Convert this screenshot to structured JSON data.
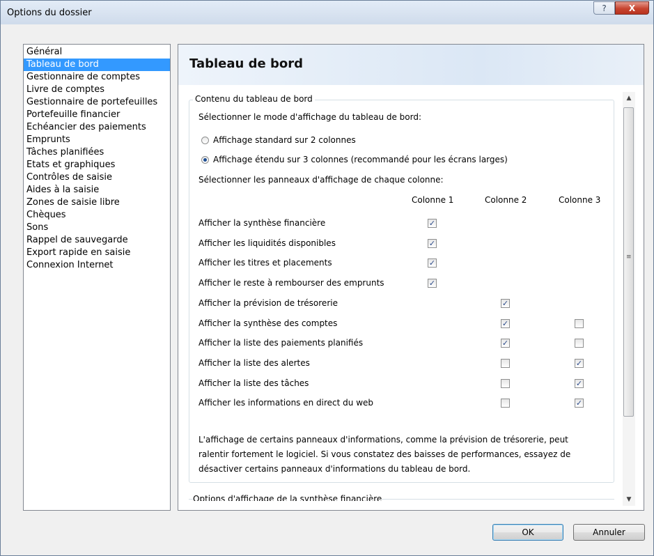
{
  "window": {
    "title": "Options du dossier",
    "help_label": "?",
    "close_label": "X"
  },
  "sidebar": {
    "items": [
      {
        "label": "Général"
      },
      {
        "label": "Tableau de bord",
        "selected": true
      },
      {
        "label": "Gestionnaire de comptes"
      },
      {
        "label": "Livre de comptes"
      },
      {
        "label": "Gestionnaire de portefeuilles"
      },
      {
        "label": "Portefeuille financier"
      },
      {
        "label": "Echéancier des paiements"
      },
      {
        "label": "Emprunts"
      },
      {
        "label": "Tâches planifiées"
      },
      {
        "label": "Etats et graphiques"
      },
      {
        "label": "Contrôles de saisie"
      },
      {
        "label": "Aides à la saisie"
      },
      {
        "label": "Zones de saisie libre"
      },
      {
        "label": "Chèques"
      },
      {
        "label": "Sons"
      },
      {
        "label": "Rappel de sauvegarde"
      },
      {
        "label": "Export rapide en saisie"
      },
      {
        "label": "Connexion Internet"
      }
    ]
  },
  "panel": {
    "title": "Tableau de bord",
    "group_title": "Contenu du tableau de bord",
    "mode_label": "Sélectionner le mode d'affichage du tableau de bord:",
    "mode_options": [
      {
        "label": "Affichage standard sur 2 colonnes",
        "selected": false
      },
      {
        "label": "Affichage étendu sur 3 colonnes (recommandé pour les écrans larges)",
        "selected": true
      }
    ],
    "panels_label": "Sélectionner les panneaux d'affichage de chaque colonne:",
    "columns": [
      "Colonne 1",
      "Colonne 2",
      "Colonne 3"
    ],
    "rows": [
      {
        "label": "Afficher la synthèse financière",
        "checks": [
          true,
          null,
          null
        ]
      },
      {
        "label": "Afficher les liquidités disponibles",
        "checks": [
          true,
          null,
          null
        ]
      },
      {
        "label": "Afficher les titres et placements",
        "checks": [
          true,
          null,
          null
        ]
      },
      {
        "label": "Afficher le reste à rembourser des emprunts",
        "checks": [
          true,
          null,
          null
        ]
      },
      {
        "label": "Afficher la prévision de trésorerie",
        "checks": [
          null,
          true,
          null
        ]
      },
      {
        "label": "Afficher la synthèse des comptes",
        "checks": [
          null,
          true,
          false
        ]
      },
      {
        "label": "Afficher la liste des paiements planifiés",
        "checks": [
          null,
          true,
          false
        ]
      },
      {
        "label": "Afficher la liste des alertes",
        "checks": [
          null,
          false,
          true
        ]
      },
      {
        "label": "Afficher la liste des tâches",
        "checks": [
          null,
          false,
          true
        ]
      },
      {
        "label": "Afficher les informations en direct du web",
        "checks": [
          null,
          false,
          true
        ]
      }
    ],
    "note_lines": [
      "L'affichage de certains panneaux d'informations, comme la prévision de trésorerie, peut",
      "ralentir fortement le logiciel. Si vous constatez des baisses de performances, essayez de",
      "désactiver certains panneaux d'informations du tableau de bord."
    ],
    "next_group_title": "Options d'affichage de la synthèse financière"
  },
  "scrollbar": {
    "up_glyph": "▲",
    "down_glyph": "▼",
    "grip_glyph": "≡"
  },
  "checkmark_glyph": "✓",
  "buttons": {
    "ok": "OK",
    "cancel": "Annuler"
  }
}
